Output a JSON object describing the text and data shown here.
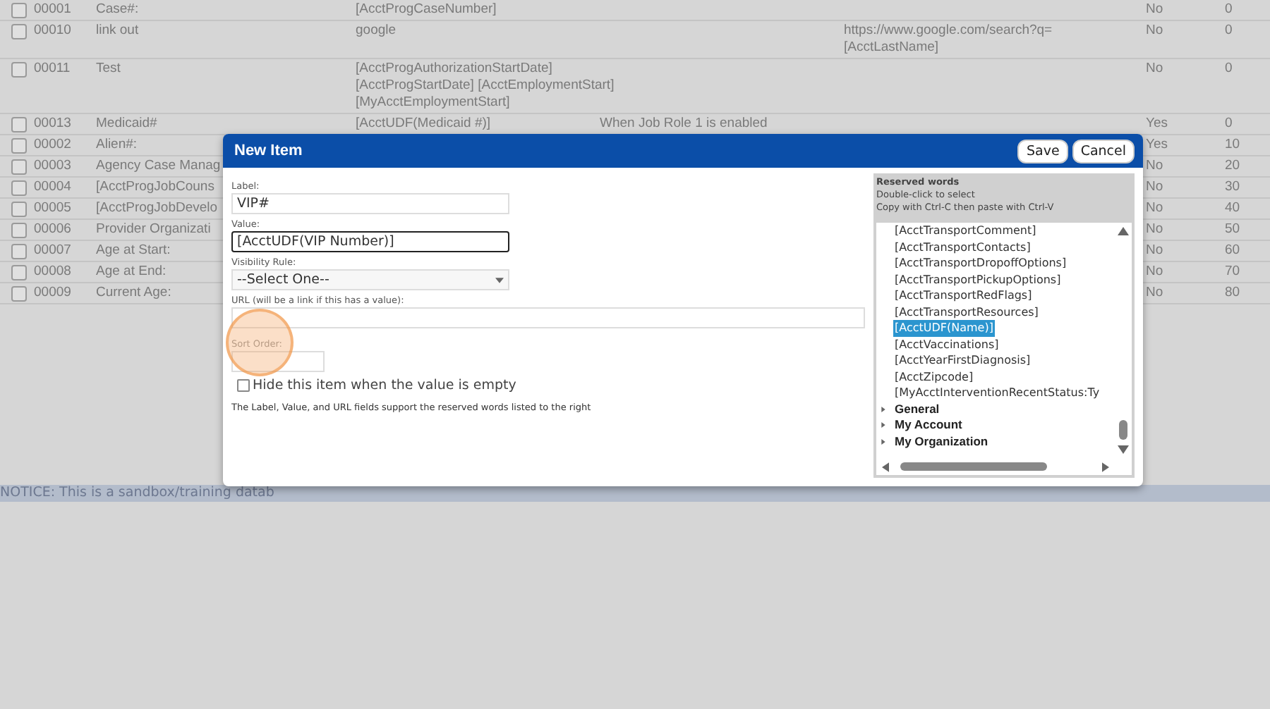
{
  "table": {
    "rows": [
      {
        "checked": false,
        "id": "00001",
        "name": "Case#:",
        "value": [
          "[AcctProgCaseNumber]"
        ],
        "condition": "",
        "url": [],
        "required": "No",
        "order": "0"
      },
      {
        "checked": false,
        "id": "00010",
        "name": "link out",
        "value": [
          "google"
        ],
        "condition": "",
        "url": [
          "https://www.google.com/search?q=",
          "[AcctLastName]"
        ],
        "required": "No",
        "order": "0"
      },
      {
        "checked": false,
        "id": "00011",
        "name": "Test",
        "value": [
          "[AcctProgAuthorizationStartDate]",
          "[AcctProgStartDate] [AcctEmploymentStart]",
          "[MyAcctEmploymentStart]"
        ],
        "condition": "",
        "url": [],
        "required": "No",
        "order": "0"
      },
      {
        "checked": false,
        "id": "00013",
        "name": "Medicaid#",
        "value": [
          "[AcctUDF(Medicaid #)]"
        ],
        "condition": "When Job Role 1 is enabled",
        "url": [],
        "required": "Yes",
        "order": "0"
      },
      {
        "checked": false,
        "id": "00002",
        "name": "Alien#:",
        "value": [],
        "condition": "",
        "url": [],
        "required": "Yes",
        "order": "10"
      },
      {
        "checked": false,
        "id": "00003",
        "name": "Agency Case Manag",
        "value": [],
        "condition": "",
        "url": [],
        "required": "No",
        "order": "20"
      },
      {
        "checked": false,
        "id": "00004",
        "name": "[AcctProgJobCouns",
        "value": [],
        "condition": "",
        "url": [],
        "required": "No",
        "order": "30"
      },
      {
        "checked": false,
        "id": "00005",
        "name": "[AcctProgJobDevelo",
        "value": [],
        "condition": "",
        "url": [],
        "required": "No",
        "order": "40"
      },
      {
        "checked": false,
        "id": "00006",
        "name": "Provider Organizati",
        "value": [],
        "condition": "",
        "url": [],
        "required": "No",
        "order": "50"
      },
      {
        "checked": false,
        "id": "00007",
        "name": "Age at Start:",
        "value": [],
        "condition": "",
        "url": [],
        "required": "No",
        "order": "60"
      },
      {
        "checked": false,
        "id": "00008",
        "name": "Age at End:",
        "value": [],
        "condition": "",
        "url": [],
        "required": "No",
        "order": "70"
      },
      {
        "checked": false,
        "id": "00009",
        "name": "Current Age:",
        "value": [],
        "condition": "",
        "url": [],
        "required": "No",
        "order": "80"
      }
    ]
  },
  "notice": "NOTICE: This is a sandbox/training datab",
  "dialog": {
    "title": "New Item",
    "buttons": [
      "Save",
      "Cancel"
    ],
    "label_field": {
      "label": "Label:",
      "value": "VIP#",
      "focused": false
    },
    "value_field": {
      "label": "Value:",
      "value": "[AcctUDF(VIP Number)]",
      "focused": true
    },
    "visibility": {
      "label": "Visibility Rule:",
      "value": "--Select One--"
    },
    "url_field": {
      "label": "URL (will be a link if this has a value):"
    },
    "sort_field": {
      "label": "Sort Order:"
    },
    "hide_empty": {
      "label": "Hide this item when the value is empty",
      "checked": false
    },
    "note": "The Label, Value, and URL fields support the reserved words listed to the right",
    "reserved": {
      "title": "Reserved words",
      "hints": [
        "Double-click to select",
        "Copy with Ctrl-C then paste with Ctrl-V"
      ],
      "items": [
        {
          "text": "[AcctTransportComment]",
          "selected": false
        },
        {
          "text": "[AcctTransportContacts]",
          "selected": false
        },
        {
          "text": "[AcctTransportDropoffOptions]",
          "selected": false
        },
        {
          "text": "[AcctTransportPickupOptions]",
          "selected": false
        },
        {
          "text": "[AcctTransportRedFlags]",
          "selected": false
        },
        {
          "text": "[AcctTransportResources]",
          "selected": false
        },
        {
          "text": "[AcctUDF(Name)]",
          "selected": true
        },
        {
          "text": "[AcctVaccinations]",
          "selected": false
        },
        {
          "text": "[AcctYearFirstDiagnosis]",
          "selected": false
        },
        {
          "text": "[AcctZipcode]",
          "selected": false
        },
        {
          "text": "[MyAcctInterventionRecentStatus:Ty",
          "selected": false
        }
      ],
      "groups": [
        {
          "label": "General",
          "expanded": false
        },
        {
          "label": "My Account",
          "expanded": false
        },
        {
          "label": "My Organization",
          "expanded": false
        }
      ]
    }
  }
}
